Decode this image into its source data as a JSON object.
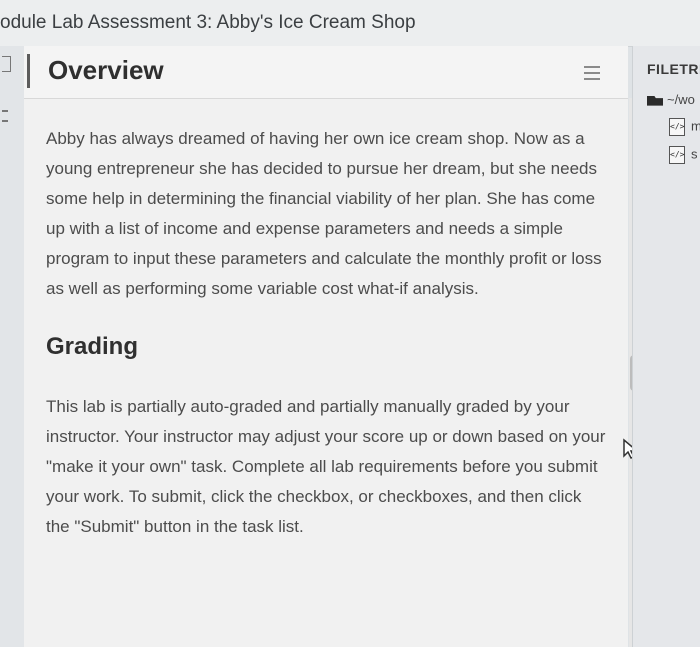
{
  "window": {
    "title": "odule Lab Assessment 3: Abby's Ice Cream Shop"
  },
  "panel": {
    "title": "Overview",
    "menu_icon": "hamburger-menu-icon",
    "overview_text": "Abby has always dreamed of having her own ice cream shop. Now as a young entrepreneur she has decided to pursue her dream, but she needs some help in determining the financial viability of her plan. She has come up with a list of income and expense parameters and needs a simple program to input these parameters and calculate the monthly profit or loss as well as performing some variable cost what-if analysis.",
    "grading_heading": "Grading",
    "grading_text": "This lab is partially auto-graded and partially manually graded by your instructor. Your instructor may adjust your score up or down based on your \"make it your own\" task. Complete all lab requirements before you submit your work. To submit, click the checkbox, or checkboxes, and then click the \"Submit\" button in the task list."
  },
  "filetree": {
    "title": "FILETRE",
    "folder_label": "~/wo",
    "files": [
      {
        "label": "m",
        "icon": "code-file-icon"
      },
      {
        "label": "s",
        "icon": "code-file-icon"
      }
    ]
  }
}
